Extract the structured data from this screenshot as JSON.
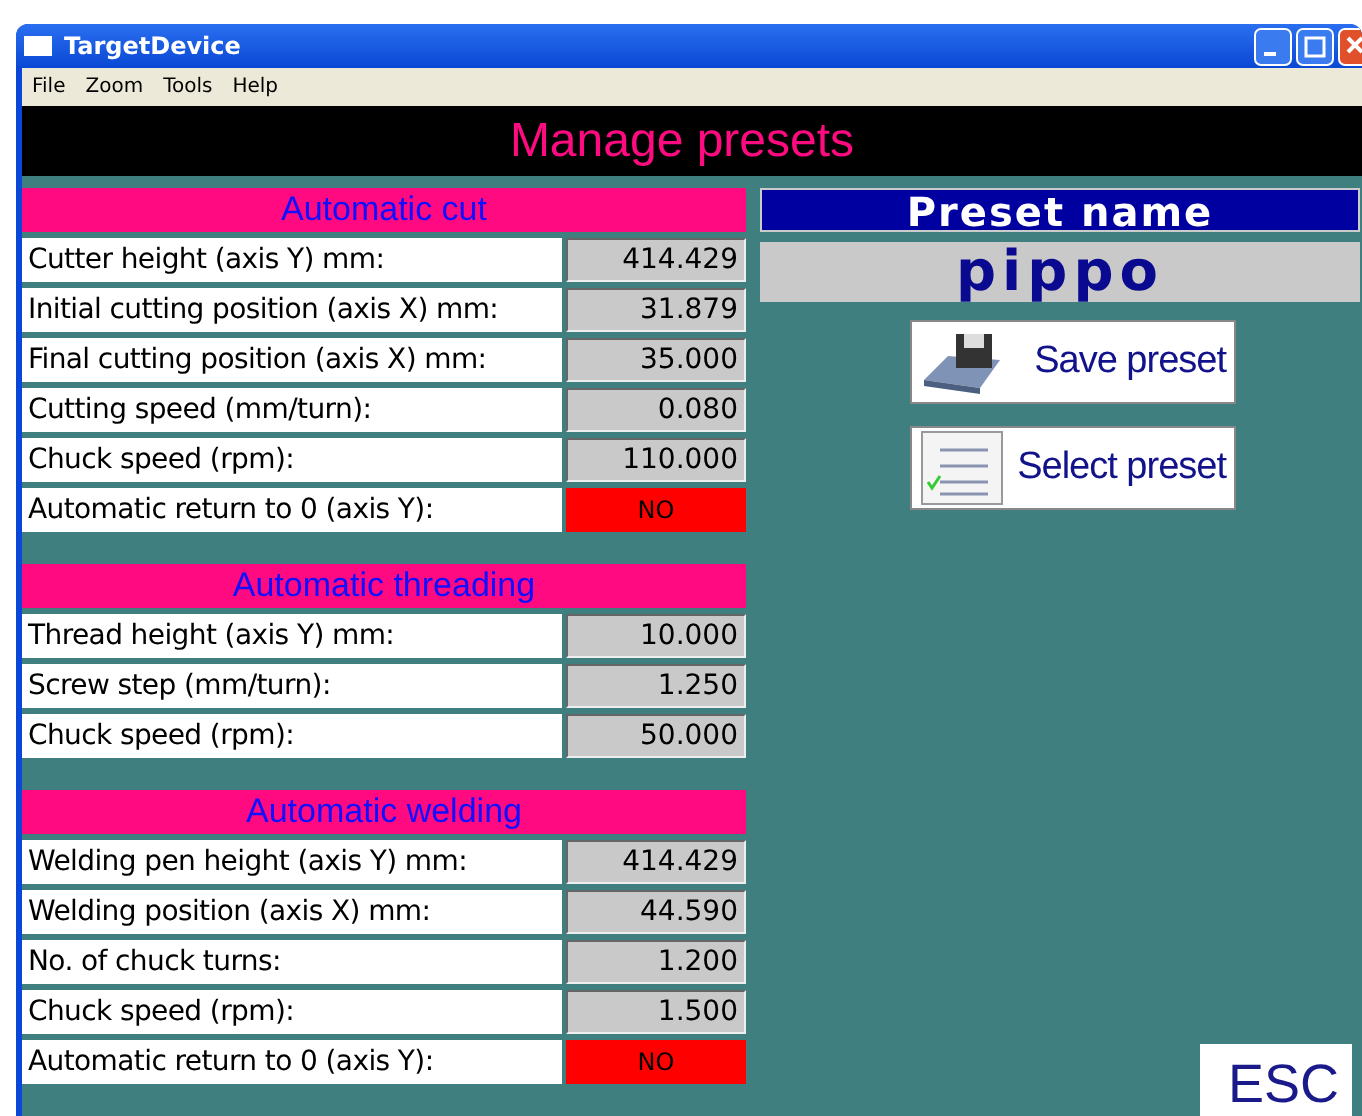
{
  "window": {
    "title": "TargetDevice"
  },
  "menu": [
    "File",
    "Zoom",
    "Tools",
    "Help"
  ],
  "header": "Manage presets",
  "sections": [
    {
      "title": "Automatic cut",
      "fields": [
        {
          "label": "Cutter height (axis Y) mm:",
          "kind": "number",
          "value": "414.429"
        },
        {
          "label": "Initial cutting position (axis X) mm:",
          "kind": "number",
          "value": "31.879"
        },
        {
          "label": "Final cutting position (axis X) mm:",
          "kind": "number",
          "value": "35.000"
        },
        {
          "label": "Cutting speed (mm/turn):",
          "kind": "number",
          "value": "0.080"
        },
        {
          "label": "Chuck speed (rpm):",
          "kind": "number",
          "value": "110.000"
        },
        {
          "label": "Automatic return to 0 (axis Y):",
          "kind": "toggle",
          "value": "NO",
          "on": false
        }
      ]
    },
    {
      "title": "Automatic threading",
      "fields": [
        {
          "label": "Thread height (axis Y) mm:",
          "kind": "number",
          "value": "10.000"
        },
        {
          "label": "Screw step (mm/turn):",
          "kind": "number",
          "value": "1.250"
        },
        {
          "label": "Chuck speed (rpm):",
          "kind": "number",
          "value": "50.000"
        }
      ]
    },
    {
      "title": "Automatic welding",
      "fields": [
        {
          "label": "Welding pen height (axis Y) mm:",
          "kind": "number",
          "value": "414.429"
        },
        {
          "label": "Welding position (axis X) mm:",
          "kind": "number",
          "value": "44.590"
        },
        {
          "label": "No. of chuck turns:",
          "kind": "number",
          "value": "1.200"
        },
        {
          "label": "Chuck speed (rpm):",
          "kind": "number",
          "value": "1.500"
        },
        {
          "label": "Automatic return to 0 (axis Y):",
          "kind": "toggle",
          "value": "NO",
          "on": false
        }
      ]
    }
  ],
  "preset": {
    "title": "Preset name",
    "name": "pippo"
  },
  "buttons": [
    {
      "label": "Save preset",
      "kind": "save"
    },
    {
      "label": "Select preset",
      "kind": "select"
    }
  ],
  "esc": "ESC"
}
